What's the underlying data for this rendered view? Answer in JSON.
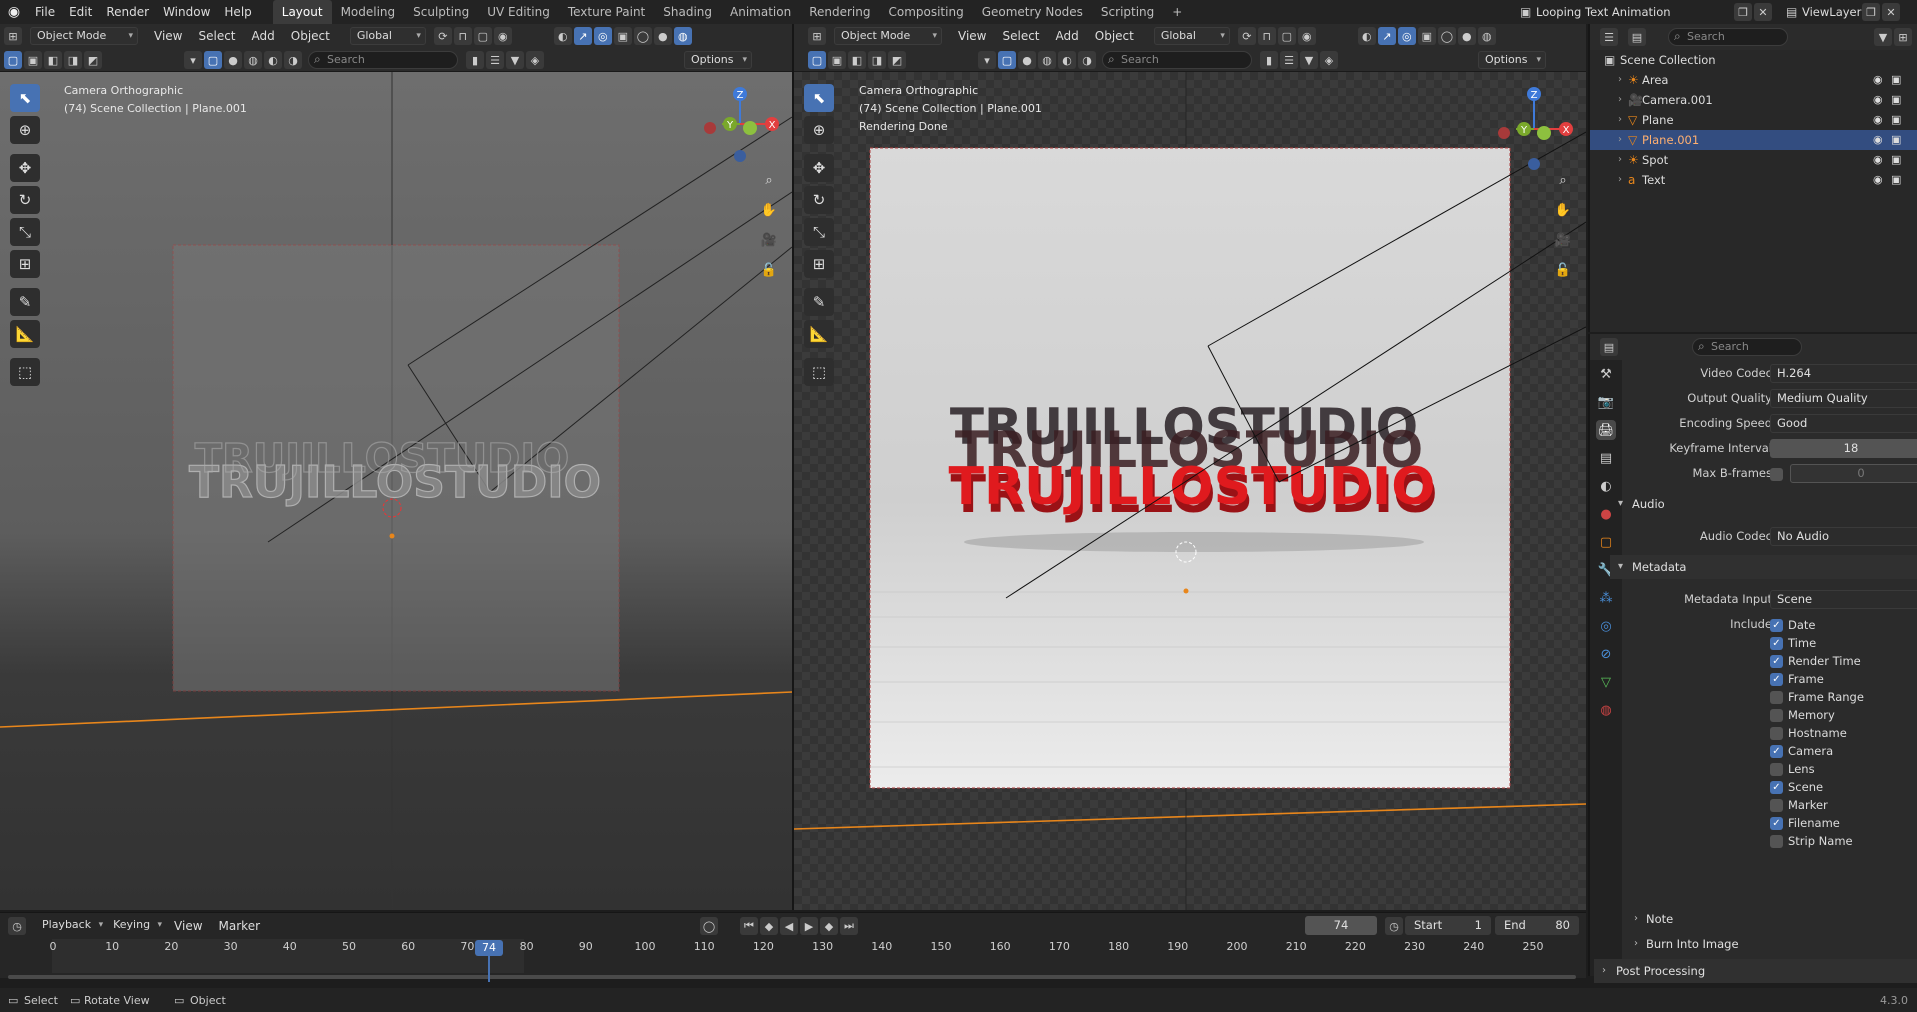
{
  "topbar": {
    "menus": [
      "File",
      "Edit",
      "Render",
      "Window",
      "Help"
    ],
    "workspaces": [
      "Layout",
      "Modeling",
      "Sculpting",
      "UV Editing",
      "Texture Paint",
      "Shading",
      "Animation",
      "Rendering",
      "Compositing",
      "Geometry Nodes",
      "Scripting"
    ],
    "active_workspace": "Layout",
    "scene_name": "Looping Text Animation",
    "view_layer": "ViewLayer"
  },
  "viewport_left": {
    "mode": "Object Mode",
    "menus": [
      "View",
      "Select",
      "Add",
      "Object"
    ],
    "orientation": "Global",
    "search_placeholder": "Search",
    "options_label": "Options",
    "overlay_line1": "Camera Orthographic",
    "overlay_line2": "(74) Scene Collection | Plane.001",
    "render_text": "TRUJILLOSTUDIO"
  },
  "viewport_right": {
    "mode": "Object Mode",
    "menus": [
      "View",
      "Select",
      "Add",
      "Object"
    ],
    "orientation": "Global",
    "search_placeholder": "Search",
    "options_label": "Options",
    "overlay_line1": "Camera Orthographic",
    "overlay_line2": "(74) Scene Collection | Plane.001",
    "overlay_line3": "Rendering Done",
    "render_text": "TRUJILLOSTUDIO"
  },
  "axes": {
    "x": "X",
    "y": "Y",
    "z": "Z"
  },
  "outliner": {
    "search_placeholder": "Search",
    "root": "Scene Collection",
    "items": [
      {
        "name": "Area",
        "icon": "light-icon",
        "selected": false
      },
      {
        "name": "Camera.001",
        "icon": "camera-icon",
        "selected": false
      },
      {
        "name": "Plane",
        "icon": "mesh-icon",
        "selected": false
      },
      {
        "name": "Plane.001",
        "icon": "mesh-icon",
        "selected": true
      },
      {
        "name": "Spot",
        "icon": "light-icon",
        "selected": false
      },
      {
        "name": "Text",
        "icon": "text-icon",
        "selected": false
      }
    ]
  },
  "properties": {
    "search_placeholder": "Search",
    "video_codec_label": "Video Codec",
    "video_codec": "H.264",
    "output_quality_label": "Output Quality",
    "output_quality": "Medium Quality",
    "encoding_speed_label": "Encoding Speed",
    "encoding_speed": "Good",
    "keyframe_label": "Keyframe Interval",
    "keyframe_value": "18",
    "bframes_label": "Max B-frames",
    "bframes_value": "0",
    "audio_section": "Audio",
    "audio_codec_label": "Audio Codec",
    "audio_codec": "No Audio",
    "metadata_section": "Metadata",
    "metadata_input_label": "Metadata Input",
    "metadata_input": "Scene",
    "include_label": "Include",
    "include": [
      {
        "label": "Date",
        "checked": true
      },
      {
        "label": "Time",
        "checked": true
      },
      {
        "label": "Render Time",
        "checked": true
      },
      {
        "label": "Frame",
        "checked": true
      },
      {
        "label": "Frame Range",
        "checked": false
      },
      {
        "label": "Memory",
        "checked": false
      },
      {
        "label": "Hostname",
        "checked": false
      },
      {
        "label": "Camera",
        "checked": true
      },
      {
        "label": "Lens",
        "checked": false
      },
      {
        "label": "Scene",
        "checked": true
      },
      {
        "label": "Marker",
        "checked": false
      },
      {
        "label": "Filename",
        "checked": true
      },
      {
        "label": "Strip Name",
        "checked": false
      }
    ],
    "note_section": "Note",
    "burn_section": "Burn Into Image",
    "post_section": "Post Processing"
  },
  "timeline": {
    "menus": [
      "Playback",
      "Keying",
      "View",
      "Marker"
    ],
    "current_frame": "74",
    "start_label": "Start",
    "start": "1",
    "end_label": "End",
    "end": "80",
    "ticks": [
      "0",
      "10",
      "20",
      "30",
      "40",
      "50",
      "60",
      "70",
      "80",
      "90",
      "100",
      "110",
      "120",
      "130",
      "140",
      "150",
      "160",
      "170",
      "180",
      "190",
      "200",
      "210",
      "220",
      "230",
      "240",
      "250"
    ]
  },
  "statusbar": {
    "select": "Select",
    "rotate": "Rotate View",
    "object": "Object",
    "version": "4.3.0"
  },
  "colors": {
    "accent": "#4772b3",
    "selected_row": "#334d80",
    "text_red": "#e01a1e",
    "orange": "#e8861b"
  }
}
